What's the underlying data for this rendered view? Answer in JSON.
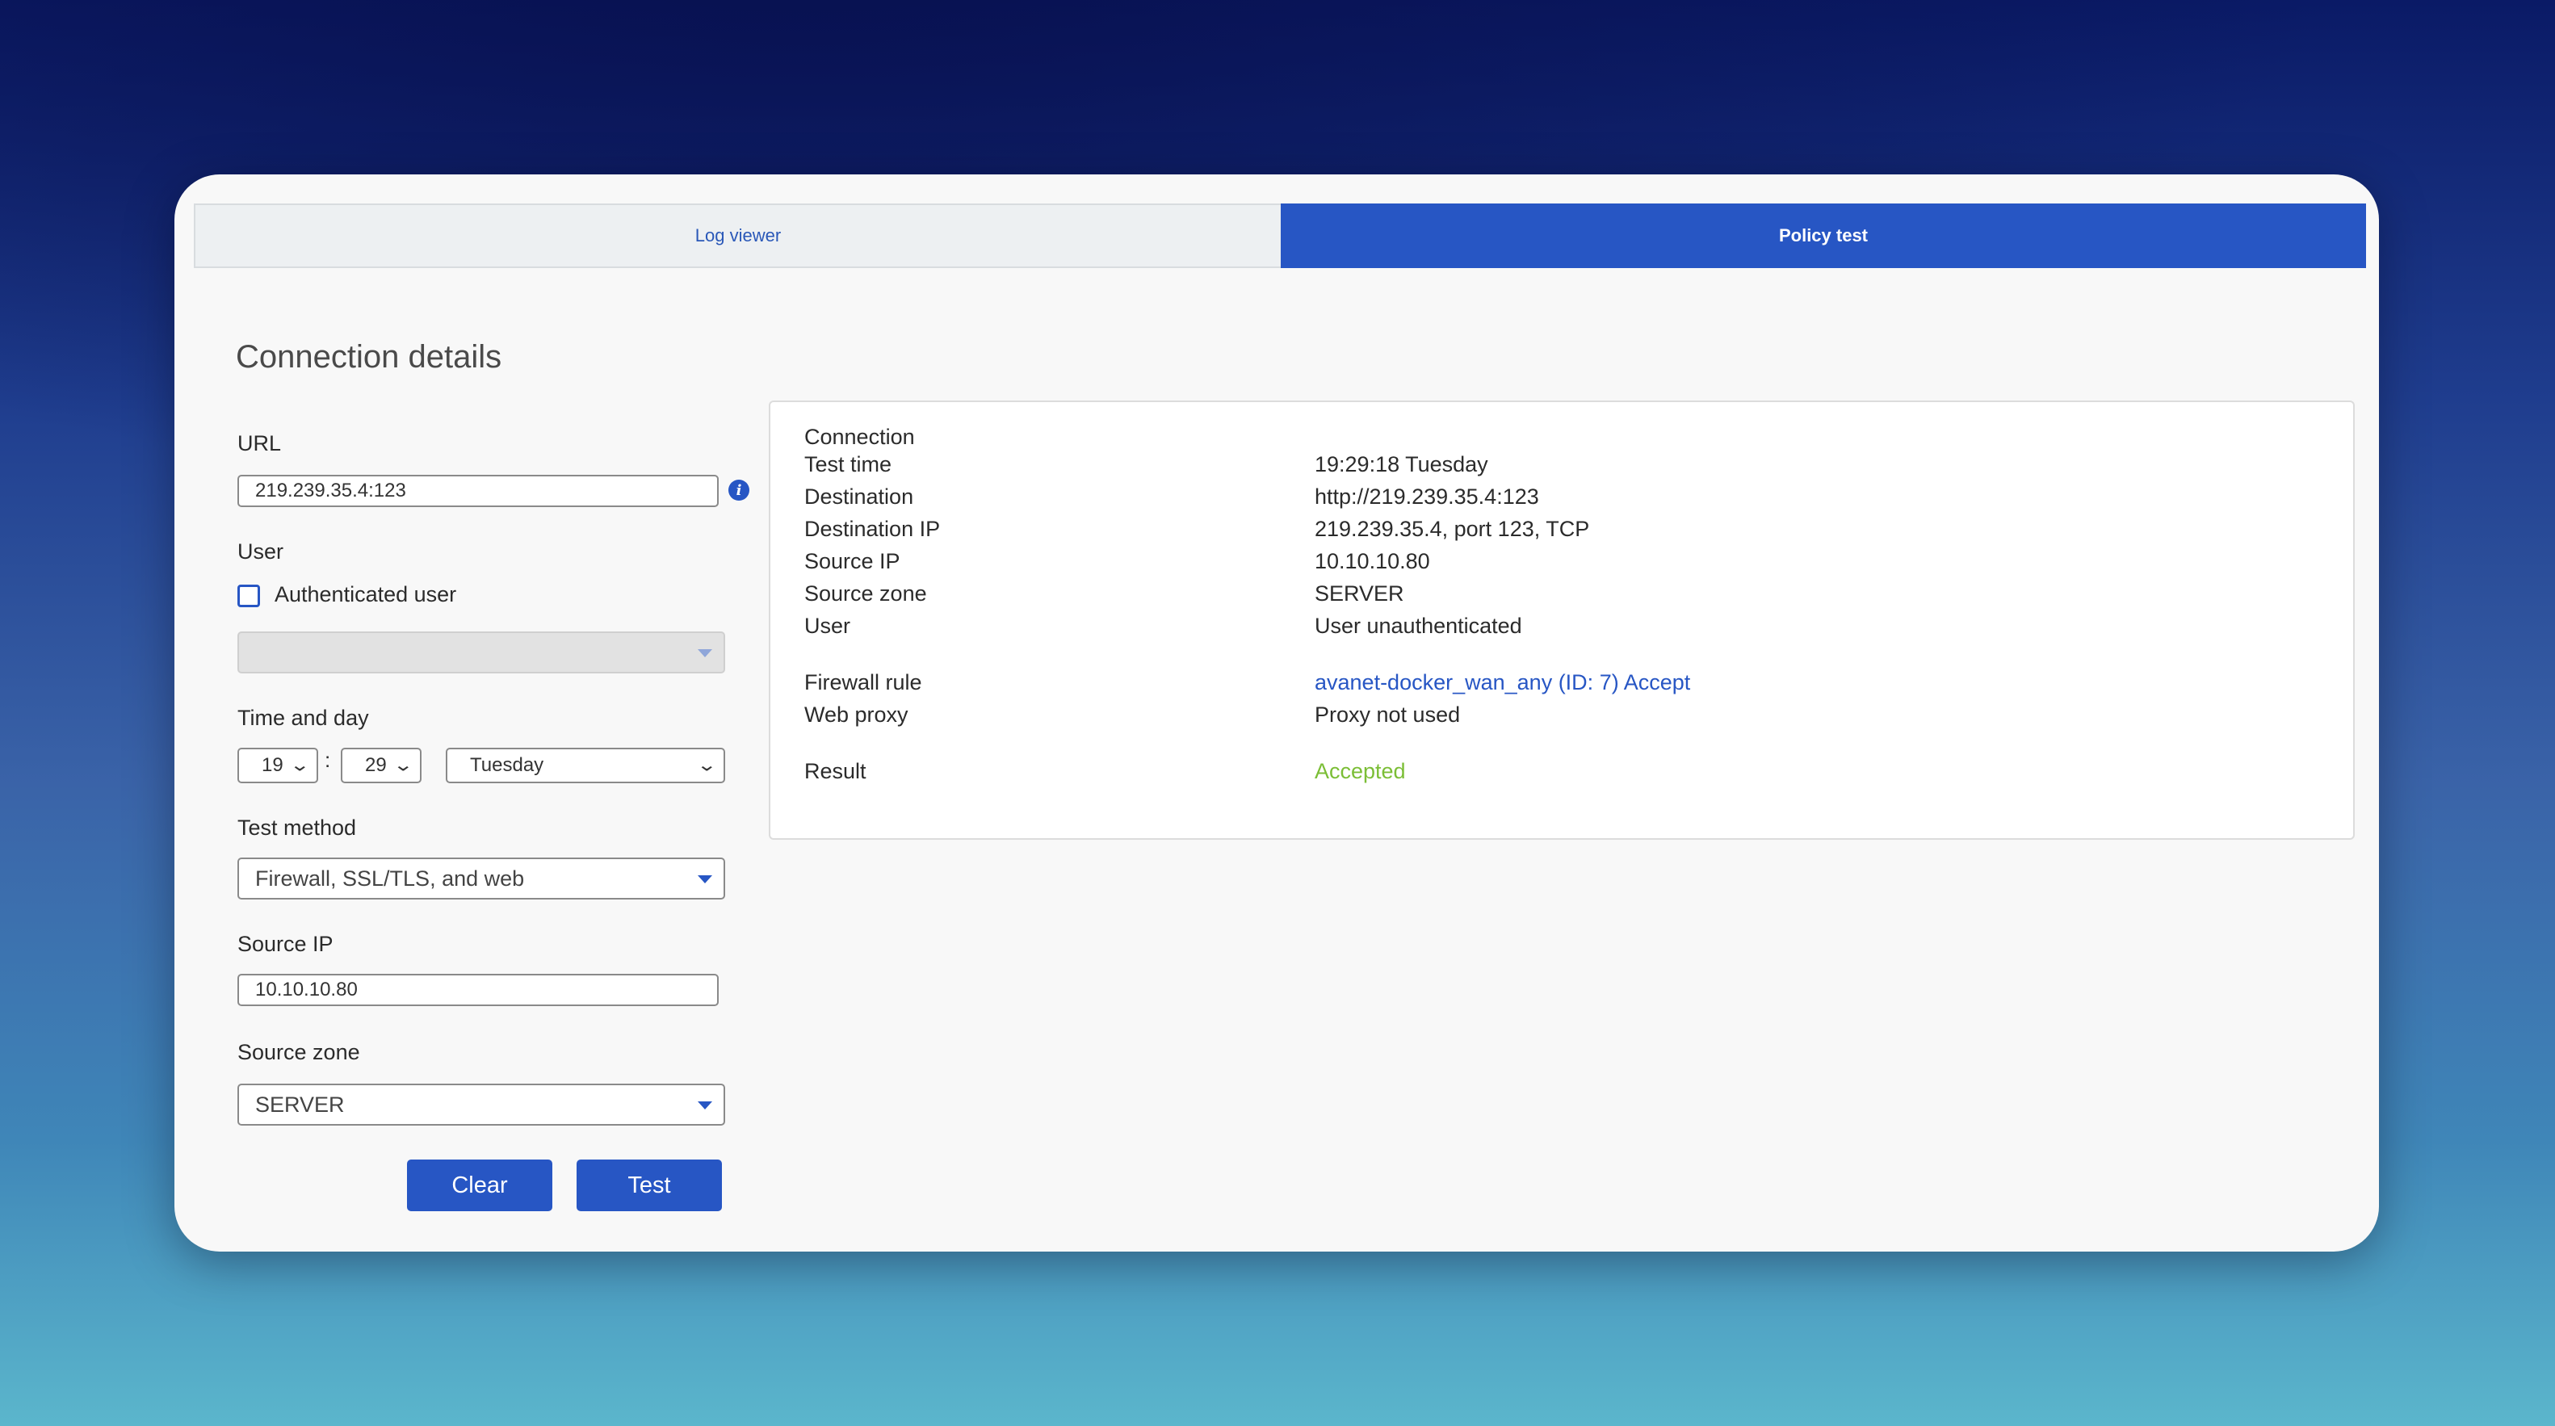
{
  "tabs": [
    {
      "label": "Log viewer",
      "active": false
    },
    {
      "label": "Policy test",
      "active": true
    }
  ],
  "section_title": "Connection details",
  "form": {
    "url": {
      "label": "URL",
      "value": "219.239.35.4:123",
      "info_icon": "info-icon"
    },
    "user": {
      "label": "User",
      "checkbox_label": "Authenticated user",
      "checked": false,
      "select_value": ""
    },
    "time_and_day": {
      "label": "Time and day",
      "hour": "19",
      "separator": ":",
      "minute": "29",
      "day": "Tuesday"
    },
    "test_method": {
      "label": "Test method",
      "value": "Firewall, SSL/TLS, and web"
    },
    "source_ip": {
      "label": "Source IP",
      "value": "10.10.10.80"
    },
    "source_zone": {
      "label": "Source zone",
      "value": "SERVER"
    },
    "buttons": {
      "clear": "Clear",
      "test": "Test"
    }
  },
  "results": {
    "heading": "Connection",
    "rows": [
      {
        "label": "Test time",
        "value": "19:29:18 Tuesday"
      },
      {
        "label": "Destination",
        "value": "http://219.239.35.4:123"
      },
      {
        "label": "Destination IP",
        "value": "219.239.35.4, port 123, TCP"
      },
      {
        "label": "Source IP",
        "value": "10.10.10.80"
      },
      {
        "label": "Source zone",
        "value": "SERVER"
      },
      {
        "label": "User",
        "value": "User unauthenticated"
      },
      {
        "label": "Firewall rule",
        "value": "avanet-docker_wan_any (ID: 7) Accept"
      },
      {
        "label": "Web proxy",
        "value": "Proxy not used"
      },
      {
        "label": "Result",
        "value": "Accepted"
      }
    ]
  },
  "colors": {
    "accent": "#2756c4",
    "accepted": "#7bbe36",
    "card_background": "#f8f8f8"
  }
}
